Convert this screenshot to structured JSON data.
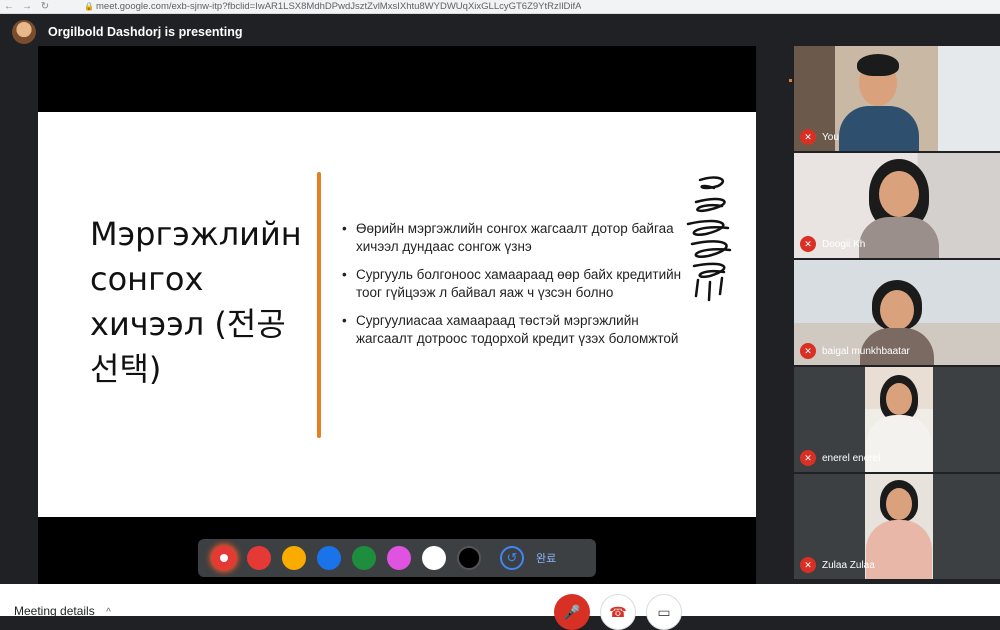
{
  "browser": {
    "back_icon": "back-arrow-icon",
    "forward_icon": "forward-arrow-icon",
    "reload_icon": "reload-icon",
    "url": "meet.google.com/exb-sjnw-itp?fbclid=IwAR1LSX8MdhDPwdJsztZvlMxsIXhtu8WYDWUqXixGLLcyGT6Z9YtRzIlDifA"
  },
  "presenter": {
    "text": "Orgilbold Dashdorj is presenting"
  },
  "slide": {
    "title": "Мэргэжлийн сонгох хичээл (전공 선택)",
    "bullets": [
      "Өөрийн мэргэжлийн сонгох жагсаалт дотор байгаа хичээл дундаас сонгож үзнэ",
      "Сургууль болгоноос хамаараад өөр байх кредитийн тоог гүйцээж л байвал яаж ч үзсэн болно",
      "Сургуулиасаа хамаараад төстэй мэргэжлийн жагсаалт дотроос тодорхой кредит үзэх боломжтой"
    ],
    "accent_color": "#e67e22"
  },
  "pen_toolbar": {
    "colors": [
      "#e53935",
      "#e53935",
      "#f9ab00",
      "#1a73e8",
      "#1e8e3e",
      "#e052e0",
      "#ffffff",
      "#000000"
    ],
    "undo_icon": "undo-icon",
    "done_label": "완료"
  },
  "participants": [
    {
      "name": "You",
      "muted": true
    },
    {
      "name": "Doogii Kh",
      "muted": true
    },
    {
      "name": "baigal munkhbaatar",
      "muted": true
    },
    {
      "name": "enerel enerel",
      "muted": true
    },
    {
      "name": "Zulaa Zulaa",
      "muted": true
    }
  ],
  "bottom": {
    "meeting_details": "Meeting details",
    "caret_icon": "chevron-up-icon",
    "mic_icon": "mic-off-icon",
    "hangup_icon": "hang-up-icon",
    "camera_icon": "camera-icon"
  }
}
